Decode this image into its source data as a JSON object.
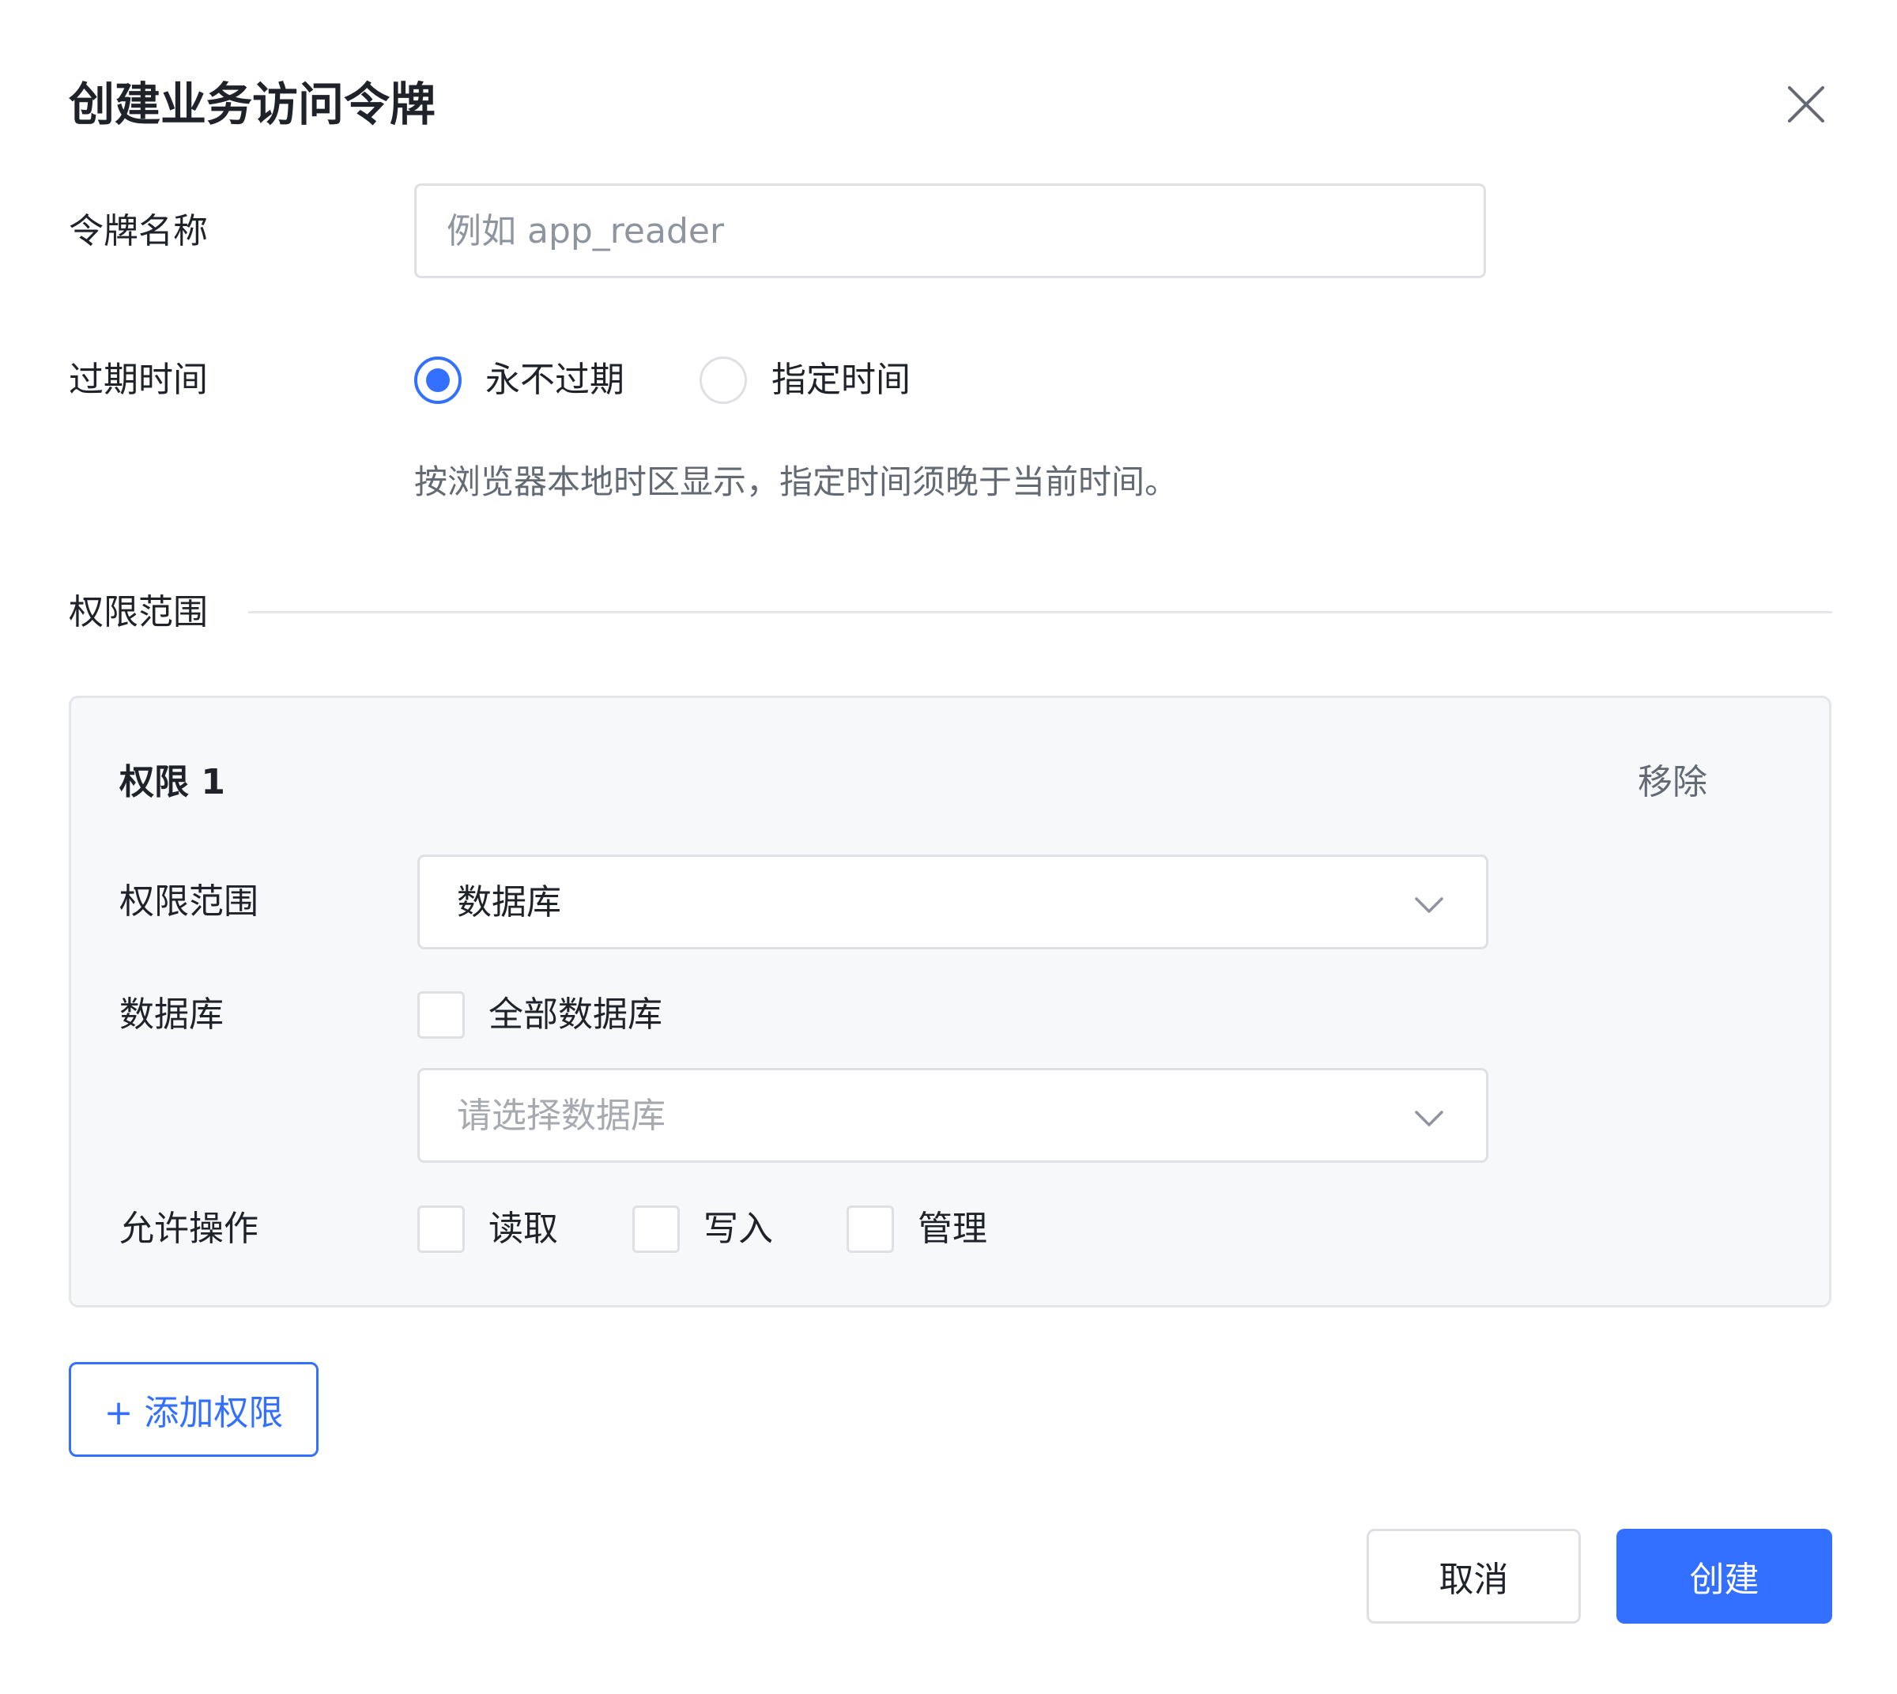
{
  "dialog": {
    "title": "创建业务访问令牌",
    "close_icon": "close-icon"
  },
  "form": {
    "token_name": {
      "label": "令牌名称",
      "value": "",
      "placeholder": "例如 app_reader"
    },
    "expiration": {
      "label": "过期时间",
      "options": [
        {
          "label": "永不过期",
          "checked": true
        },
        {
          "label": "指定时间",
          "checked": false
        }
      ],
      "hint": "按浏览器本地时区显示，指定时间须晚于当前时间。"
    },
    "scope_section": {
      "title": "权限范围"
    }
  },
  "permissions": [
    {
      "title": "权限 1",
      "remove_label": "移除",
      "scope": {
        "label": "权限范围",
        "selected": "数据库"
      },
      "database": {
        "label": "数据库",
        "all_label": "全部数据库",
        "all_checked": false,
        "select_placeholder": "请选择数据库"
      },
      "operations": {
        "label": "允许操作",
        "items": [
          {
            "label": "读取",
            "checked": false
          },
          {
            "label": "写入",
            "checked": false
          },
          {
            "label": "管理",
            "checked": false
          }
        ]
      }
    }
  ],
  "actions": {
    "add_permission": "+ 添加权限",
    "cancel": "取消",
    "create": "创建"
  },
  "colors": {
    "accent": "#3370ff",
    "border": "#dee0e3",
    "panel_bg": "#f7f8fa",
    "text": "#1f2329",
    "muted": "#646a73"
  }
}
